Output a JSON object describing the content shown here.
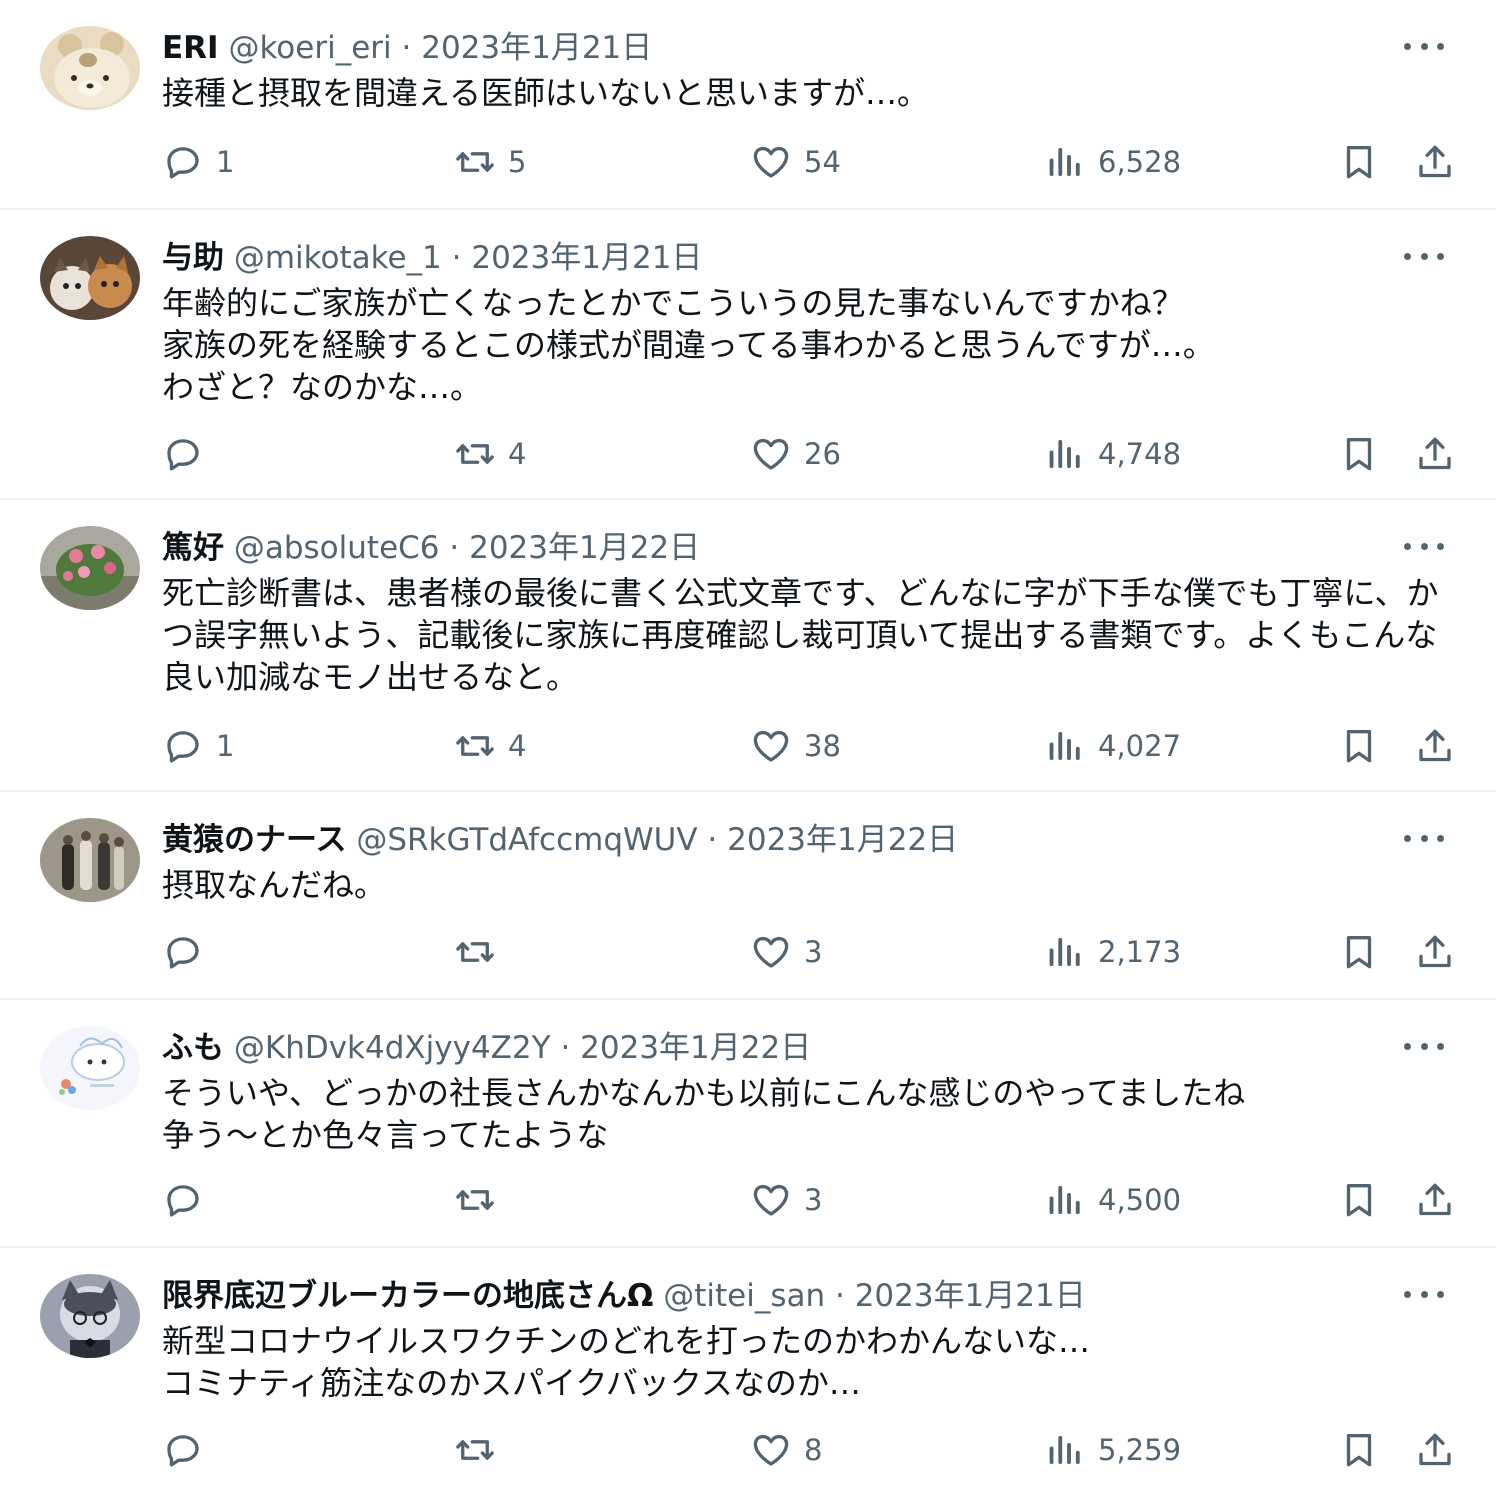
{
  "tweets": [
    {
      "name": "ERI",
      "handle": "@koeri_eri",
      "sep": "·",
      "date": "2023年1月21日",
      "text": "接種と摂取を間違える医師はいないと思いますが…。",
      "replies": "1",
      "retweets": "5",
      "likes": "54",
      "views": "6,528",
      "avatar_color": "#e9dcc2"
    },
    {
      "name": "与助",
      "handle": "@mikotake_1",
      "sep": "·",
      "date": "2023年1月21日",
      "text": "年齢的にご家族が亡くなったとかでこういうの見た事ないんですかね？\n家族の死を経験するとこの様式が間違ってる事わかると思うんですが…。\nわざと？なのかな…。",
      "replies": "",
      "retweets": "4",
      "likes": "26",
      "views": "4,748",
      "avatar_color": "#8a6a4e"
    },
    {
      "name": "篤好",
      "handle": "@absoluteC6",
      "sep": "·",
      "date": "2023年1月22日",
      "text": "死亡診断書は、患者様の最後に書く公式文章です、どんなに字が下手な僕でも丁寧に、かつ誤字無いよう、記載後に家族に再度確認し裁可頂いて提出する書類です。よくもこんな良い加減なモノ出せるなと。",
      "replies": "1",
      "retweets": "4",
      "likes": "38",
      "views": "4,027",
      "avatar_color": "#6f8a5a"
    },
    {
      "name": "黄猿のナース",
      "handle": "@SRkGTdAfccmqWUV",
      "sep": "·",
      "date": "2023年1月22日",
      "text": "摂取なんだね。",
      "replies": "",
      "retweets": "",
      "likes": "3",
      "views": "2,173",
      "avatar_color": "#7d776c"
    },
    {
      "name": "ふも",
      "handle": "@KhDvk4dXjyy4Z2Y",
      "sep": "·",
      "date": "2023年1月22日",
      "text": "そういや、どっかの社長さんかなんかも以前にこんな感じのやってましたね\n争う〜とか色々言ってたような",
      "replies": "",
      "retweets": "",
      "likes": "3",
      "views": "4,500",
      "avatar_color": "#f4f6fb"
    },
    {
      "name": "限界底辺ブルーカラーの地底さんΩ",
      "handle": "@titei_san",
      "sep": "·",
      "date": "2023年1月21日",
      "text": "新型コロナウイルスワクチンのどれを打ったのかわかんないな…\nコミナティ筋注なのかスパイクバックスなのか…",
      "replies": "",
      "retweets": "",
      "likes": "8",
      "views": "5,259",
      "avatar_color": "#9aa0ad"
    }
  ],
  "icons": {
    "reply": "reply-icon",
    "retweet": "retweet-icon",
    "like": "heart-icon",
    "views": "views-icon",
    "bookmark": "bookmark-icon",
    "share": "share-icon",
    "more": "more-icon"
  }
}
